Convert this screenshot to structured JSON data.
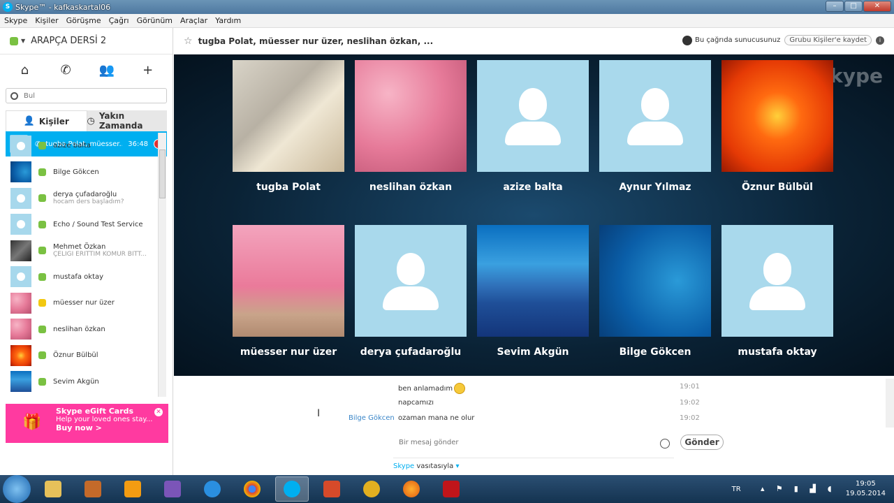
{
  "window": {
    "title": "Skype™ - kafkaskartal06"
  },
  "menu": [
    "Skype",
    "Kişiler",
    "Görüşme",
    "Çağrı",
    "Görünüm",
    "Araçlar",
    "Yardım"
  ],
  "sidebar": {
    "profile_name": "ARAPÇA DERSİ 2",
    "search_placeholder": "Bul",
    "tabs": {
      "contacts": "Kişiler",
      "recent": "Yakın Zamanda"
    },
    "active_call": {
      "name": "tugba Polat, müesser...",
      "duration": "36:48"
    },
    "contacts": [
      {
        "name": "azize balta",
        "sub": "",
        "status": "online",
        "avatar": "default"
      },
      {
        "name": "Bilge Gökcen",
        "sub": "",
        "status": "online",
        "avatar": "sea"
      },
      {
        "name": "derya çufadaroğlu",
        "sub": "hocam ders başladım?",
        "status": "online",
        "avatar": "default"
      },
      {
        "name": "Echo / Sound Test Service",
        "sub": "",
        "status": "online",
        "avatar": "default"
      },
      {
        "name": "Mehmet Özkan",
        "sub": "ÇELİĞİ ERİTTİM KÖMÜR BİTT...",
        "status": "online",
        "avatar": "photo"
      },
      {
        "name": "mustafa oktay",
        "sub": "",
        "status": "online",
        "avatar": "default"
      },
      {
        "name": "müesser nur üzer",
        "sub": "",
        "status": "away",
        "avatar": "pink"
      },
      {
        "name": "neslihan özkan",
        "sub": "",
        "status": "online",
        "avatar": "pink"
      },
      {
        "name": "Öznur Bülbül",
        "sub": "",
        "status": "online",
        "avatar": "orange"
      },
      {
        "name": "Sevim Akgün",
        "sub": "",
        "status": "online",
        "avatar": "mount"
      }
    ],
    "gift": {
      "title": "Skype eGift Cards",
      "line": "Help your loved ones stay...",
      "cta": "Buy now >"
    }
  },
  "header": {
    "conversation_title": "tugba Polat, müesser nur üzer, neslihan özkan, ...",
    "host_text": "Bu çağrıda sunucusunuz",
    "save_group_button": "Grubu Kişiler'e kaydet"
  },
  "stage": {
    "watermark": "skype",
    "participants": [
      {
        "name": "tugba Polat",
        "photo": "baby"
      },
      {
        "name": "neslihan özkan",
        "photo": "pink"
      },
      {
        "name": "azize balta",
        "photo": "default"
      },
      {
        "name": "Aynur Yılmaz",
        "photo": "default"
      },
      {
        "name": "Öznur Bülbül",
        "photo": "orange"
      },
      {
        "name": "müesser nur üzer",
        "photo": "pink2"
      },
      {
        "name": "derya çufadaroğlu",
        "photo": "default"
      },
      {
        "name": "Sevim Akgün",
        "photo": "mount"
      },
      {
        "name": "Bilge Gökcen",
        "photo": "sea"
      },
      {
        "name": "mustafa oktay",
        "photo": "default"
      }
    ]
  },
  "chat": {
    "messages": [
      {
        "sender": "",
        "text": "ben anlamadım",
        "time": "19:01"
      },
      {
        "sender": "",
        "text": "napcamızı",
        "time": "19:02"
      },
      {
        "sender": "Bilge Gökcen",
        "text": "ozaman mana ne olur",
        "time": "19:02"
      }
    ],
    "compose_placeholder": "Bir mesaj gönder",
    "send_button": "Gönder",
    "via_brand": "Skype",
    "via_text": "vasıtasıyla"
  },
  "taskbar": {
    "language": "TR",
    "time": "19:05",
    "date": "19.05.2014"
  }
}
